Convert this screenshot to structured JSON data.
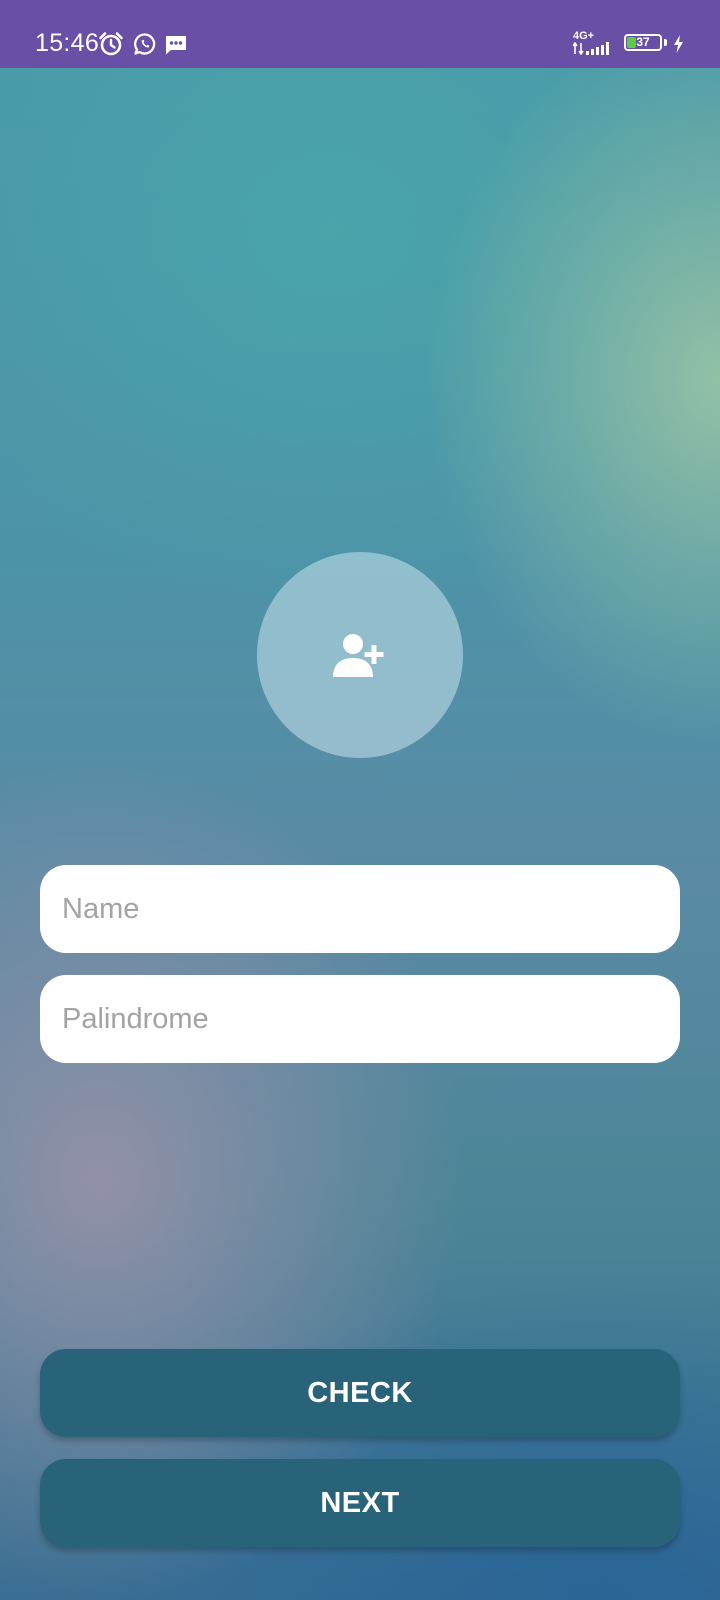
{
  "status_bar": {
    "time": "15:46",
    "network": "4G+",
    "battery_level": "37",
    "background_color": "#6a4fa6",
    "icons": [
      "alarm-icon",
      "whatsapp-icon",
      "message-icon",
      "signal-icon",
      "battery-icon",
      "charging-icon"
    ]
  },
  "avatar": {
    "icon": "add-person-icon"
  },
  "form": {
    "name_placeholder": "Name",
    "palindrome_placeholder": "Palindrome"
  },
  "actions": {
    "check_label": "CHECK",
    "next_label": "NEXT",
    "button_color": "#29637a"
  }
}
